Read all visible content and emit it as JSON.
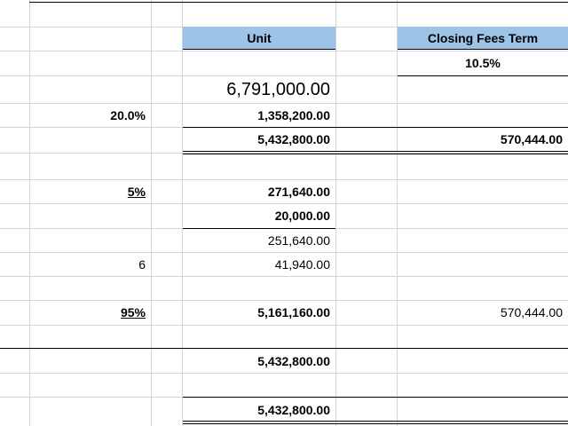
{
  "sheet": {
    "headers": {
      "unit": "Unit",
      "closing": "Closing Fees Term"
    },
    "closing_rate": "10.5%",
    "unit_price": "6,791,000.00",
    "down_payment": {
      "rate": "20.0%",
      "amount": "1,358,200.00"
    },
    "financed": {
      "amount": "5,432,800.00",
      "closing_fee": "570,444.00"
    },
    "fee": {
      "rate": "5%",
      "amount": "271,640.00"
    },
    "deduction": "20,000.00",
    "net_fee": "251,640.00",
    "installments": {
      "count": "6",
      "amount": "41,940.00"
    },
    "remaining": {
      "rate": "95%",
      "amount": "5,161,160.00",
      "closing_fee": "570,444.00"
    },
    "total_1": "5,432,800.00",
    "total_2": "5,432,800.00"
  }
}
